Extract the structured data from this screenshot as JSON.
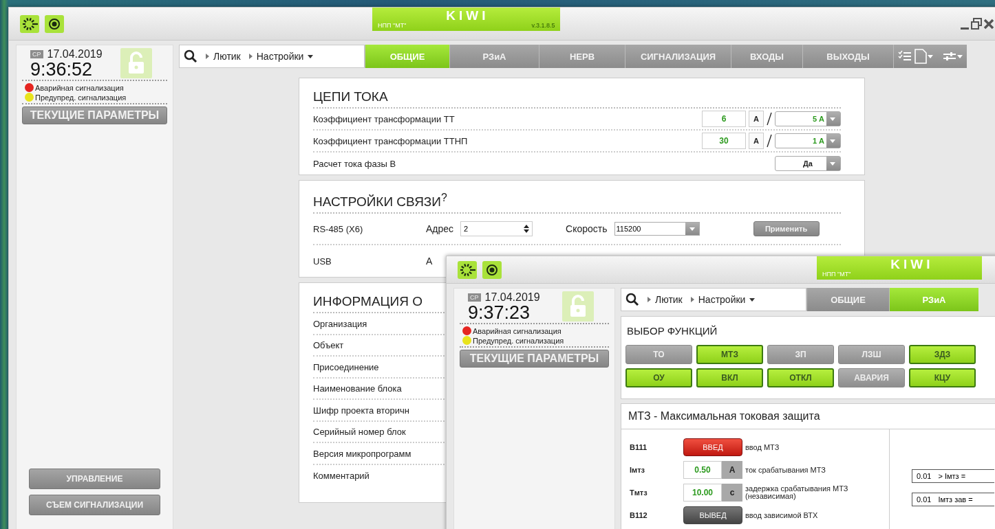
{
  "windows": [
    {
      "kind": "settings",
      "title_bar": {
        "company": "НПП \"МТ\"",
        "product": "KIWI",
        "version": "v.3.1.8.5"
      },
      "status_panel": {
        "day": "СР",
        "date": "17.04.2019",
        "time": "9:36:52",
        "alarms": [
          {
            "label": "Аварийная сигнализация",
            "color": "#e52521"
          },
          {
            "label": "Предупред. сигнализация",
            "color": "#e8e31c"
          }
        ],
        "params_button": "ТЕКУЩИЕ ПАРАМЕТРЫ",
        "bottom_buttons": [
          "УПРАВЛЕНИЕ",
          "СЪЕМ СИГНАЛИЗАЦИИ"
        ]
      },
      "breadcrumb": [
        "Лютик",
        "Настройки"
      ],
      "tabs": [
        {
          "label": "ОБЩИЕ",
          "selected": true
        },
        {
          "label": "РЗиА",
          "selected": false
        },
        {
          "label": "НЕРВ",
          "selected": false
        },
        {
          "label": "СИГНАЛИЗАЦИЯ",
          "selected": false
        },
        {
          "label": "ВХОДЫ",
          "selected": false
        },
        {
          "label": "ВЫХОДЫ",
          "selected": false
        }
      ],
      "sections": [
        {
          "kind": "current",
          "title": "ЦЕПИ ТОКА",
          "rows": [
            {
              "kind": "ratio",
              "label": "Коэффициент трансформации ТТ",
              "value": "6",
              "unit": "А",
              "secondary": "5 А"
            },
            {
              "kind": "ratio",
              "label": "Коэффициент трансформации ТТНП",
              "value": "30",
              "unit": "А",
              "secondary": "1 А"
            },
            {
              "kind": "choice",
              "label": "Расчет тока фазы В",
              "choice": "Да"
            }
          ]
        },
        {
          "kind": "comm",
          "title": "НАСТРОЙКИ СВЯЗИ$^{?}$",
          "rows": [
            {
              "kind": "full",
              "port": "RS-485 (X6)",
              "address_label": "Адрес",
              "address": "2",
              "speed_label": "Скорость",
              "speed": "115200",
              "apply": "Применить"
            },
            {
              "kind": "partial",
              "port": "USB",
              "address_label": "А"
            }
          ]
        },
        {
          "kind": "info",
          "title": "ИНФОРМАЦИЯ О",
          "rows": [
            "Организация",
            "Объект",
            "Присоединение",
            "Наименование блока",
            "Шифр проекта вторичн",
            "Серийный номер блок",
            "Версия микропрограмм",
            "Комментарий"
          ]
        }
      ]
    },
    {
      "kind": "rza",
      "title_bar": {
        "company": "НПП \"МТ\"",
        "product": "KIWI"
      },
      "status_panel": {
        "day": "СР",
        "date": "17.04.2019",
        "time": "9:37:23",
        "alarms": [
          {
            "label": "Аварийная сигнализация",
            "color": "#e52521"
          },
          {
            "label": "Предупред. сигнализация",
            "color": "#e8e31c"
          }
        ],
        "params_button": "ТЕКУЩИЕ ПАРАМЕТРЫ"
      },
      "breadcrumb": [
        "Лютик",
        "Настройки"
      ],
      "tabs": [
        {
          "label": "ОБЩИЕ",
          "selected": false
        },
        {
          "label": "РЗиА",
          "selected": true
        }
      ],
      "sections": [
        {
          "kind": "functions",
          "title": "ВЫБОР ФУНКЦИЙ",
          "buttons": [
            {
              "label": "ТО",
              "on": false
            },
            {
              "label": "МТЗ",
              "on": true
            },
            {
              "label": "ЗП",
              "on": false
            },
            {
              "label": "ЛЗШ",
              "on": false
            },
            {
              "label": "ЗДЗ",
              "on": true
            },
            {
              "label": "ОУ",
              "on": true
            },
            {
              "label": "ВКЛ",
              "on": true
            },
            {
              "label": "ОТКЛ",
              "on": true
            },
            {
              "label": "АВАРИЯ",
              "on": false
            },
            {
              "label": "КЦУ",
              "on": true
            }
          ]
        },
        {
          "kind": "protection",
          "title": "МТЗ - Максимальная токовая защита",
          "rows": [
            {
              "kind": "switch",
              "code": "В111",
              "state": "ВВЕД",
              "on": true,
              "desc": "ввод МТЗ"
            },
            {
              "kind": "value",
              "code": "Iмтз",
              "value": "0.50",
              "unit": "А",
              "desc": "ток срабатывания МТЗ"
            },
            {
              "kind": "value",
              "code": "Tмтз",
              "value": "10.00",
              "unit": "с",
              "desc": "задержка срабатывания МТЗ (независимая)"
            },
            {
              "kind": "switch",
              "code": "В112",
              "state": "ВЫВЕД",
              "on": false,
              "desc": "ввод зависимой ВТХ"
            }
          ],
          "readouts": [
            {
              "value": "0.01",
              "label": "> Iмтз ="
            },
            {
              "value": "0.01",
              "label": "Iмтз зав ="
            }
          ]
        }
      ]
    }
  ]
}
